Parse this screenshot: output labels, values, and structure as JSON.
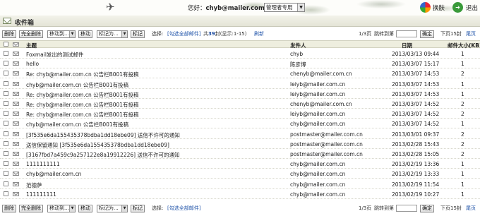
{
  "header": {
    "greeting_prefix": "您好：",
    "user_email": "chyb@mailer.com.cn",
    "manage_select": "管理者专用",
    "skin_label": "换肤",
    "exit_label": "退出"
  },
  "title": "收件箱",
  "toolbar": {
    "delete": "删除",
    "delete_all": "完全删除",
    "move_to": "移动到...",
    "move": "移动",
    "mark_as": "标记为...",
    "mark": "标记",
    "select_label": "选择:",
    "select_all": "[勾选全部邮件]",
    "count_prefix": "共",
    "count": "39",
    "count_suffix": "封(显示:1-15)",
    "refresh": "刷新",
    "page_info": "1/3页",
    "jump_label": "跳转到第",
    "confirm": "确定",
    "next_page": "下页15封",
    "last_page": "尾页"
  },
  "table": {
    "columns": {
      "subject": "主题",
      "sender": "发件人",
      "date": "日期",
      "size": "邮件大小(KB)"
    },
    "rows": [
      {
        "subject": "Foxmail发出的测试邮件",
        "sender": "chyb",
        "date": "2013/03/13 09:44",
        "size": "1"
      },
      {
        "subject": "hello",
        "sender": "陈彦博",
        "date": "2013/03/07 15:17",
        "size": "1"
      },
      {
        "subject": "Re: chyb@mailer.com.cn 公告栏B001有投稿",
        "sender": "chenyb@mailer.com.cn",
        "date": "2013/03/07 14:53",
        "size": "2"
      },
      {
        "subject": "chyb@mailer.com.cn 公告栏B001有投稿",
        "sender": "leiyb@mailer.com.cn",
        "date": "2013/03/07 14:53",
        "size": "1"
      },
      {
        "subject": "Re: chyb@mailer.com.cn 公告栏B001有投稿",
        "sender": "leiyb@mailer.com.cn",
        "date": "2013/03/07 14:53",
        "size": "1"
      },
      {
        "subject": "Re: chyb@mailer.com.cn 公告栏B001有投稿",
        "sender": "chenyb@mailer.com.cn",
        "date": "2013/03/07 14:52",
        "size": "2"
      },
      {
        "subject": "Re: chyb@mailer.com.cn 公告栏B001有投稿",
        "sender": "leiyb@mailer.com.cn",
        "date": "2013/03/07 14:52",
        "size": "2"
      },
      {
        "subject": "chyb@mailer.com.cn 公告栏B001有投稿",
        "sender": "chyb@mailer.com.cn",
        "date": "2013/03/07 14:52",
        "size": "1"
      },
      {
        "subject": "[3f535e6da155435378bdba1dd18ebe09] 送信不许可的通知",
        "sender": "postmaster@mailer.com.cn",
        "date": "2013/03/01 09:37",
        "size": "2"
      },
      {
        "subject": "送信保留通知 [3f535e6da155435378bdba1dd18ebe09]",
        "sender": "postmaster@mailer.com.cn",
        "date": "2013/02/28 15:43",
        "size": "2"
      },
      {
        "subject": "[3167fbd7a459c9a257122e8a19912226] 送信不许可的通知",
        "sender": "postmaster@mailer.com.cn",
        "date": "2013/02/28 15:05",
        "size": "2"
      },
      {
        "subject": "1111111111",
        "sender": "chyb@mailer.com.cn",
        "date": "2013/02/19 13:36",
        "size": "1"
      },
      {
        "subject": "chyb@mailer.com.cn",
        "sender": "chyb@mailer.com.cn",
        "date": "2013/02/19 13:33",
        "size": "1"
      },
      {
        "subject": "范德萨",
        "sender": "chyb@mailer.com.cn",
        "date": "2013/02/19 11:54",
        "size": "1"
      },
      {
        "subject": "111111111",
        "sender": "chyb@mailer.com.cn",
        "date": "2013/02/19 10:27",
        "size": "1"
      }
    ]
  }
}
